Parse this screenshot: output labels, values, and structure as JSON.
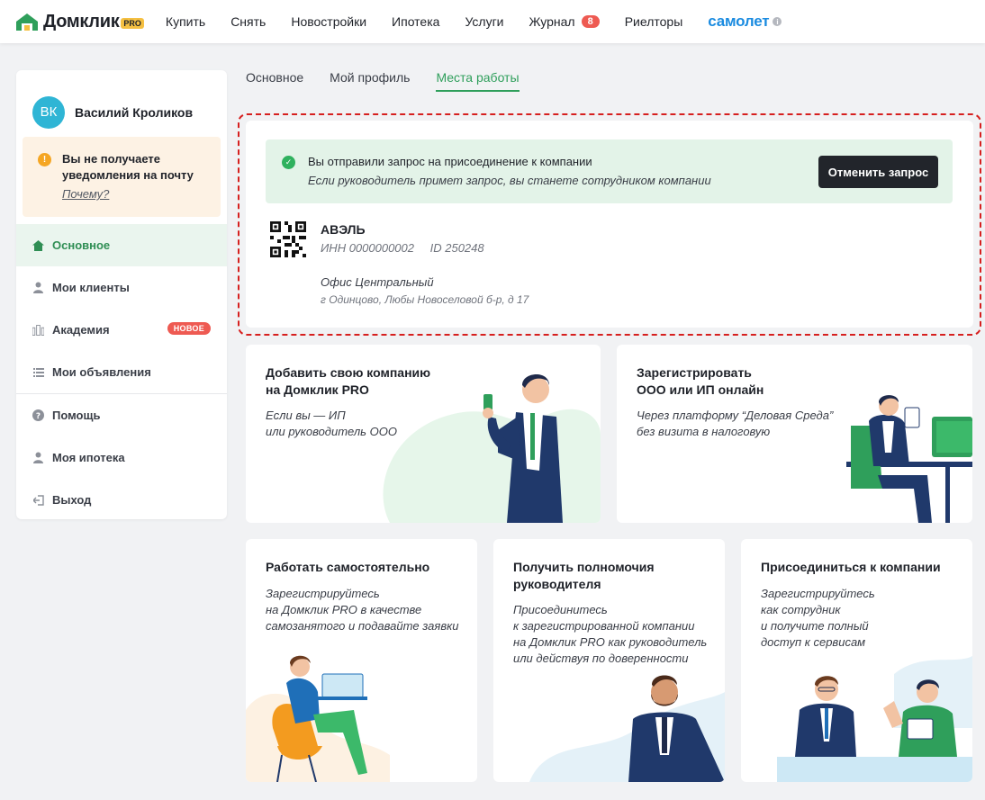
{
  "header": {
    "logo_text": "Домклик",
    "logo_badge": "PRO",
    "nav": [
      "Купить",
      "Снять",
      "Новостройки",
      "Ипотека",
      "Услуги",
      "Журнал",
      "Риелторы"
    ],
    "journal_badge": "8",
    "samolet": "самолет",
    "info_glyph": "i",
    "colors": {
      "brand_green": "#2f9f5b",
      "samolet_blue": "#1a8be0",
      "badge_red": "#ee5a52"
    }
  },
  "sidebar": {
    "avatar_initials": "ВК",
    "user_name": "Василий Кроликов",
    "notice": {
      "text": "Вы не получаете уведомления на почту",
      "link": "Почему?",
      "icon": "warning-icon",
      "glyph": "!"
    },
    "menu": [
      {
        "label": "Основное",
        "icon": "home-icon",
        "active": true
      },
      {
        "label": "Мои клиенты",
        "icon": "user-icon"
      },
      {
        "label": "Академия",
        "icon": "academy-icon",
        "badge": "НОВОЕ"
      },
      {
        "label": "Мои объявления",
        "icon": "list-icon"
      },
      {
        "label": "Помощь",
        "icon": "help-icon"
      },
      {
        "label": "Моя ипотека",
        "icon": "user-icon"
      },
      {
        "label": "Выход",
        "icon": "logout-icon"
      }
    ]
  },
  "tabs": [
    "Основное",
    "Мой профиль",
    "Места работы"
  ],
  "active_tab": "Места работы",
  "company": {
    "alert_title": "Вы отправили запрос на присоединение к компании",
    "alert_sub": "Если руководитель примет запрос, вы станете сотрудником компании",
    "alert_glyph": "✓",
    "cancel_button": "Отменить запрос",
    "name": "АВЭЛЬ",
    "inn": "ИНН 0000000002",
    "id": "ID 250248",
    "office": "Офис Центральный",
    "address": "г Одинцово, Любы Новоселовой б-р, д 17"
  },
  "cards": [
    {
      "title": "Добавить свою компанию\nна Домклик PRO",
      "desc": "Если вы — ИП\nили руководитель ООО"
    },
    {
      "title": "Зарегистрировать\nООО или ИП онлайн",
      "desc": "Через платформу “Деловая Среда”\nбез визита в налоговую"
    },
    {
      "title": "Работать самостоятельно",
      "desc": "Зарегистрируйтесь\nна Домклик PRO в качестве\nсамозанятого и подавайте заявки"
    },
    {
      "title": "Получить полномочия\nруководителя",
      "desc": "Присоединитесь\nк зарегистрированной компании\nна Домклик PRO как руководитель\nили действуя по доверенности"
    },
    {
      "title": "Присоединиться к компании",
      "desc": "Зарегистрируйтесь\nкак сотрудник\nи получите полный\nдоступ к сервисам"
    }
  ]
}
